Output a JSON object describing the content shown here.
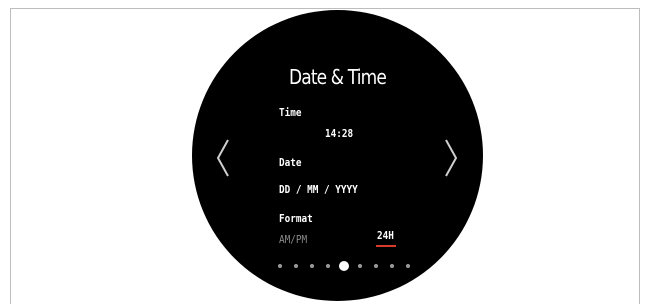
{
  "screen": {
    "title": "Date & Time",
    "time_label": "Time",
    "time_value": "14:28",
    "date_label": "Date",
    "date_value": "DD / MM / YYYY",
    "format_label": "Format",
    "format_options": [
      "AM/PM",
      "24H"
    ],
    "format_selected": "24H"
  },
  "pagination": {
    "total": 9,
    "active_index": 4
  },
  "colors": {
    "watch_face": "#000000",
    "text": "#ffffff",
    "inactive_text": "#8a8a8a",
    "accent_underline": "#d93a2b",
    "inactive_dot": "#9a9a9a"
  },
  "icons": {
    "prev": "chevron-left-icon",
    "next": "chevron-right-icon"
  }
}
